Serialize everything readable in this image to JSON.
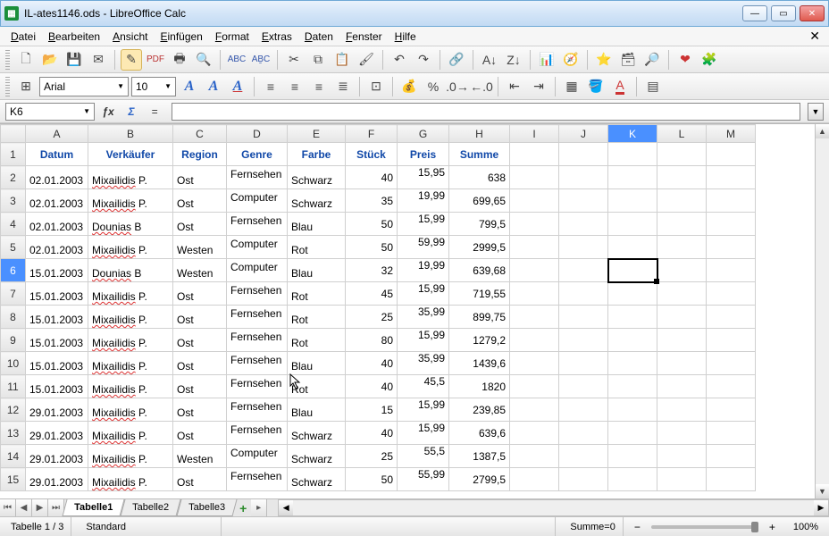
{
  "window": {
    "title": "IL-ates1146.ods - LibreOffice Calc"
  },
  "menu": [
    "Datei",
    "Bearbeiten",
    "Ansicht",
    "Einfügen",
    "Format",
    "Extras",
    "Daten",
    "Fenster",
    "Hilfe"
  ],
  "format_toolbar": {
    "font_name": "Arial",
    "font_size": "10"
  },
  "formula_bar": {
    "cell_ref": "K6",
    "formula": ""
  },
  "columns": [
    "A",
    "B",
    "C",
    "D",
    "E",
    "F",
    "G",
    "H",
    "I",
    "J",
    "K",
    "L",
    "M"
  ],
  "selected_col_hdr": "K",
  "selected_row_hdr": 6,
  "headers": {
    "A": "Datum",
    "B": "Verkäufer",
    "C": "Region",
    "D": "Genre",
    "E": "Farbe",
    "F": "Stück",
    "G": "Preis",
    "H": "Summe"
  },
  "rows": [
    {
      "n": 2,
      "A": "02.01.2003",
      "B": "Mixailidis P.",
      "C": "Ost",
      "D": "Fernsehen",
      "E": "Schwarz",
      "F": "40",
      "G": "15,95",
      "H": "638"
    },
    {
      "n": 3,
      "A": "02.01.2003",
      "B": "Mixailidis P.",
      "C": "Ost",
      "D": "Computer",
      "E": "Schwarz",
      "F": "35",
      "G": "19,99",
      "H": "699,65"
    },
    {
      "n": 4,
      "A": "02.01.2003",
      "B": "Dounias B",
      "C": "Ost",
      "D": "Fernsehen",
      "E": "Blau",
      "F": "50",
      "G": "15,99",
      "H": "799,5"
    },
    {
      "n": 5,
      "A": "02.01.2003",
      "B": "Mixailidis P.",
      "C": "Westen",
      "D": "Computer",
      "E": "Rot",
      "F": "50",
      "G": "59,99",
      "H": "2999,5"
    },
    {
      "n": 6,
      "A": "15.01.2003",
      "B": "Dounias B",
      "C": "Westen",
      "D": "Computer",
      "E": "Blau",
      "F": "32",
      "G": "19,99",
      "H": "639,68"
    },
    {
      "n": 7,
      "A": "15.01.2003",
      "B": "Mixailidis P.",
      "C": "Ost",
      "D": "Fernsehen",
      "E": "Rot",
      "F": "45",
      "G": "15,99",
      "H": "719,55"
    },
    {
      "n": 8,
      "A": "15.01.2003",
      "B": "Mixailidis P.",
      "C": "Ost",
      "D": "Fernsehen",
      "E": "Rot",
      "F": "25",
      "G": "35,99",
      "H": "899,75"
    },
    {
      "n": 9,
      "A": "15.01.2003",
      "B": "Mixailidis P.",
      "C": "Ost",
      "D": "Fernsehen",
      "E": "Rot",
      "F": "80",
      "G": "15,99",
      "H": "1279,2"
    },
    {
      "n": 10,
      "A": "15.01.2003",
      "B": "Mixailidis P.",
      "C": "Ost",
      "D": "Fernsehen",
      "E": "Blau",
      "F": "40",
      "G": "35,99",
      "H": "1439,6"
    },
    {
      "n": 11,
      "A": "15.01.2003",
      "B": "Mixailidis P.",
      "C": "Ost",
      "D": "Fernsehen",
      "E": "Rot",
      "F": "40",
      "G": "45,5",
      "H": "1820"
    },
    {
      "n": 12,
      "A": "29.01.2003",
      "B": "Mixailidis P.",
      "C": "Ost",
      "D": "Fernsehen",
      "E": "Blau",
      "F": "15",
      "G": "15,99",
      "H": "239,85"
    },
    {
      "n": 13,
      "A": "29.01.2003",
      "B": "Mixailidis P.",
      "C": "Ost",
      "D": "Fernsehen",
      "E": "Schwarz",
      "F": "40",
      "G": "15,99",
      "H": "639,6"
    },
    {
      "n": 14,
      "A": "29.01.2003",
      "B": "Mixailidis P.",
      "C": "Westen",
      "D": "Computer",
      "E": "Schwarz",
      "F": "25",
      "G": "55,5",
      "H": "1387,5"
    },
    {
      "n": 15,
      "A": "29.01.2003",
      "B": "Mixailidis P.",
      "C": "Ost",
      "D": "Fernsehen",
      "E": "Schwarz",
      "F": "50",
      "G": "55,99",
      "H": "2799,5"
    }
  ],
  "wavy_cols": [
    "B"
  ],
  "tabs": {
    "active": "Tabelle1",
    "list": [
      "Tabelle1",
      "Tabelle2",
      "Tabelle3"
    ]
  },
  "status": {
    "sheet_info": "Tabelle 1 / 3",
    "mode": "Standard",
    "sum": "Summe=0",
    "zoom": "100%"
  },
  "col_widths": {
    "A": 70,
    "B": 95,
    "C": 60,
    "D": 68,
    "E": 65,
    "F": 58,
    "G": 58,
    "H": 68,
    "I": 55,
    "J": 55,
    "K": 55,
    "L": 55,
    "M": 55
  }
}
